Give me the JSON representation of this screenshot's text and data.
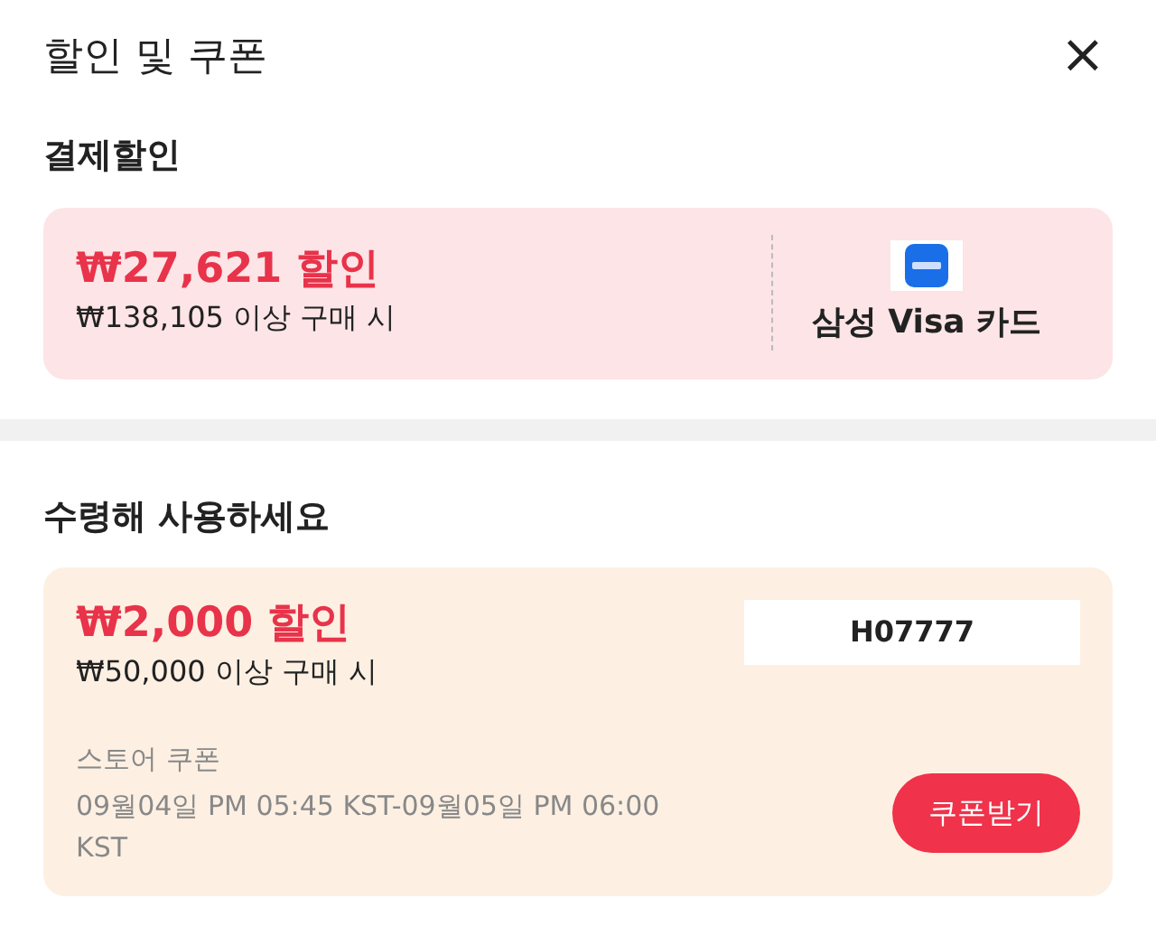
{
  "header": {
    "title": "할인 및 쿠폰",
    "close": "×"
  },
  "payment_section": {
    "title": "결제할인",
    "offer": {
      "amount": "₩27,621 할인",
      "condition": "₩138,105 이상 구매 시",
      "card_name": "삼성 Visa 카드"
    }
  },
  "coupon_section": {
    "title": "수령해 사용하세요",
    "coupons": [
      {
        "amount": "₩2,000 할인",
        "condition": "₩50,000 이상 구매 시",
        "code": "H07777",
        "type": "스토어 쿠폰",
        "period": "09월04일 PM 05:45 KST-09월05일 PM 06:00 KST",
        "button": "쿠폰받기"
      }
    ]
  }
}
